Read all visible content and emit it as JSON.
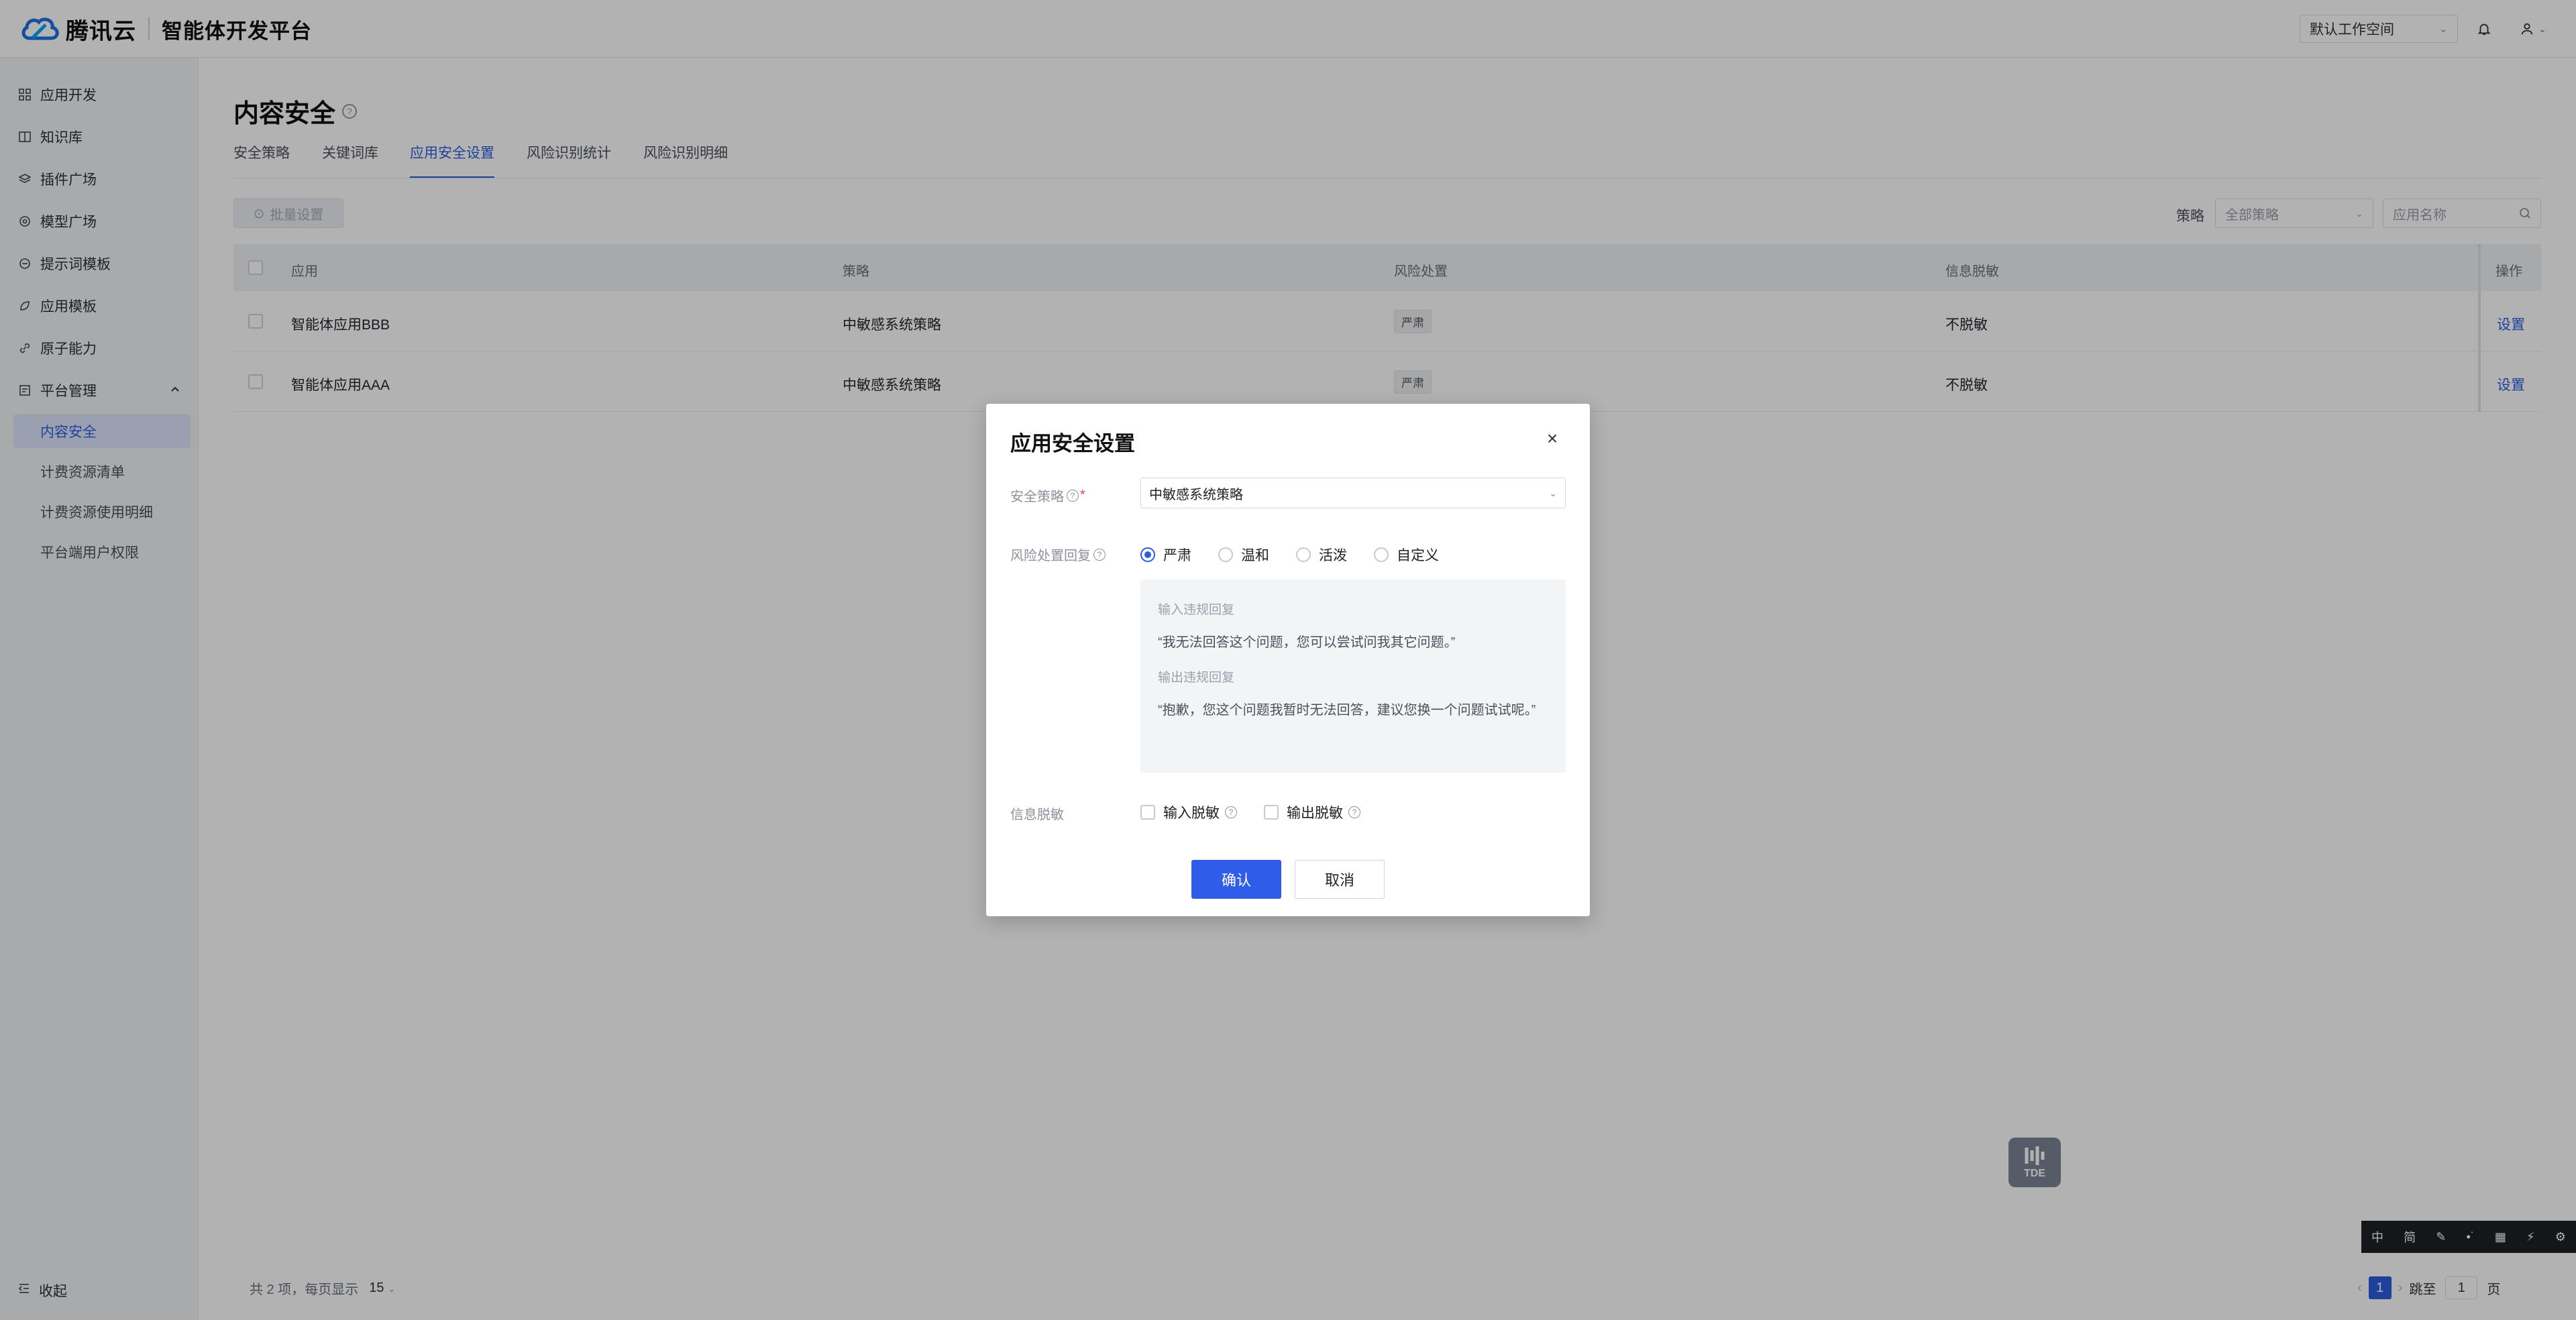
{
  "header": {
    "brand": "腾讯云",
    "product": "智能体开发平台",
    "workspace": "默认工作空间"
  },
  "sidebar": {
    "items": [
      {
        "label": "应用开发",
        "icon": "grid-icon"
      },
      {
        "label": "知识库",
        "icon": "book-icon"
      },
      {
        "label": "插件广场",
        "icon": "layers-icon"
      },
      {
        "label": "模型广场",
        "icon": "model-icon"
      },
      {
        "label": "提示词模板",
        "icon": "prompt-icon"
      },
      {
        "label": "应用模板",
        "icon": "template-icon"
      },
      {
        "label": "原子能力",
        "icon": "link-icon"
      },
      {
        "label": "平台管理",
        "icon": "manage-icon"
      }
    ],
    "sub_items": [
      {
        "label": "内容安全",
        "active": true
      },
      {
        "label": "计费资源清单",
        "active": false
      },
      {
        "label": "计费资源使用明细",
        "active": false
      },
      {
        "label": "平台端用户权限",
        "active": false
      }
    ],
    "collapse_label": "收起"
  },
  "page": {
    "title": "内容安全",
    "tabs": [
      {
        "label": "安全策略",
        "active": false
      },
      {
        "label": "关键词库",
        "active": false
      },
      {
        "label": "应用安全设置",
        "active": true
      },
      {
        "label": "风险识别统计",
        "active": false
      },
      {
        "label": "风险识别明细",
        "active": false
      }
    ],
    "batch_button": "批量设置",
    "filter_label": "策略",
    "filter_value": "全部策略",
    "search_placeholder": "应用名称"
  },
  "table": {
    "headers": [
      "应用",
      "策略",
      "风险处置",
      "信息脱敏",
      "操作"
    ],
    "rows": [
      {
        "app": "智能体应用BBB",
        "policy": "中敏感系统策略",
        "risk": "严肃",
        "mask": "不脱敏",
        "op": "设置"
      },
      {
        "app": "智能体应用AAA",
        "policy": "中敏感系统策略",
        "risk": "严肃",
        "mask": "不脱敏",
        "op": "设置"
      }
    ]
  },
  "pagination": {
    "total_text": "共 2 项，每页显示",
    "page_size": "15",
    "current_page": "1",
    "jump_label": "跳至",
    "jump_value": "1",
    "page_suffix": "页"
  },
  "widget": {
    "label": "TDE"
  },
  "ime_toolbar": {
    "items": [
      "中",
      "简",
      "✎",
      "•˙",
      "▦",
      "⚡",
      "⚙"
    ]
  },
  "modal": {
    "title": "应用安全设置",
    "policy_label": "安全策略",
    "policy_value": "中敏感系统策略",
    "risk_label": "风险处置回复",
    "risk_options": [
      {
        "label": "严肃",
        "checked": true
      },
      {
        "label": "温和",
        "checked": false
      },
      {
        "label": "活泼",
        "checked": false
      },
      {
        "label": "自定义",
        "checked": false
      }
    ],
    "input_reply_caption": "输入违规回复",
    "input_reply_text": "“我无法回答这个问题，您可以尝试问我其它问题。”",
    "output_reply_caption": "输出违规回复",
    "output_reply_text": "“抱歉，您这个问题我暂时无法回答，建议您换一个问题试试呢。”",
    "mask_label": "信息脱敏",
    "mask_options": [
      {
        "label": "输入脱敏",
        "checked": false
      },
      {
        "label": "输出脱敏",
        "checked": false
      }
    ],
    "confirm_label": "确认",
    "cancel_label": "取消"
  },
  "colors": {
    "accent": "#2b5de0",
    "primary_button": "#2f5ce8",
    "overlay": "rgba(0,0,0,0.30)"
  }
}
